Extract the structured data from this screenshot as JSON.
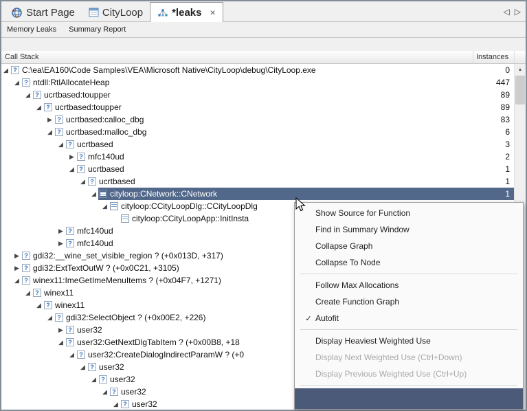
{
  "colors": {
    "selection_bg": "#52688a",
    "selection_text": "#ffffff",
    "menu_partial_bg": "#4a5a78",
    "accent_blue": "#2f6fbe",
    "disabled_text": "#a9a9a9"
  },
  "tab_bar": {
    "tabs": [
      {
        "label": "Start Page",
        "icon": "start-page-globe-icon",
        "active": false
      },
      {
        "label": "CityLoop",
        "icon": "document-window-icon",
        "active": false
      },
      {
        "label": "*leaks",
        "icon": "leak-graph-icon",
        "active": true,
        "close_label": "×"
      }
    ],
    "nav_back_glyph": "◁",
    "nav_forward_glyph": "▷"
  },
  "subtabs": [
    {
      "label": "Memory Leaks"
    },
    {
      "label": "Summary Report"
    }
  ],
  "table": {
    "columns": [
      "Call Stack",
      "Instances"
    ]
  },
  "tree": {
    "expanded_glyph": "◢",
    "collapsed_glyph": "▶",
    "unknown_glyph": "?",
    "rows": [
      {
        "level": 0,
        "state": "expanded",
        "icon": "question",
        "label": "C:\\ea\\EA160\\Code Samples\\VEA\\Microsoft Native\\CityLoop\\debug\\CityLoop.exe",
        "instances": "0",
        "selected": false
      },
      {
        "level": 1,
        "state": "expanded",
        "icon": "question",
        "label": "ntdll:RtlAllocateHeap",
        "instances": "447",
        "selected": false
      },
      {
        "level": 2,
        "state": "expanded",
        "icon": "question",
        "label": "ucrtbased:toupper",
        "instances": "89",
        "selected": false
      },
      {
        "level": 3,
        "state": "expanded",
        "icon": "question",
        "label": "ucrtbased:toupper",
        "instances": "89",
        "selected": false
      },
      {
        "level": 4,
        "state": "collapsed",
        "icon": "question",
        "label": "ucrtbased:calloc_dbg",
        "instances": "83",
        "selected": false
      },
      {
        "level": 4,
        "state": "expanded",
        "icon": "question",
        "label": "ucrtbased:malloc_dbg",
        "instances": "6",
        "selected": false
      },
      {
        "level": 5,
        "state": "expanded",
        "icon": "question",
        "label": "ucrtbased",
        "instances": "3",
        "selected": false
      },
      {
        "level": 6,
        "state": "collapsed",
        "icon": "question",
        "label": "mfc140ud",
        "instances": "2",
        "selected": false
      },
      {
        "level": 6,
        "state": "expanded",
        "icon": "question",
        "label": "ucrtbased",
        "instances": "1",
        "selected": false
      },
      {
        "level": 7,
        "state": "expanded",
        "icon": "question",
        "label": "ucrtbased",
        "instances": "1",
        "selected": false
      },
      {
        "level": 8,
        "state": "expanded",
        "icon": "doc",
        "label": "cityloop:CNetwork::CNetwork",
        "instances": "1",
        "selected": true
      },
      {
        "level": 9,
        "state": "expanded",
        "icon": "doc",
        "label": "cityloop:CCityLoopDlg::CCityLoopDlg",
        "instances": "",
        "selected": false
      },
      {
        "level": 10,
        "state": "leaf",
        "icon": "doc",
        "label": "cityloop:CCityLoopApp::InitInsta",
        "instances": "",
        "selected": false
      },
      {
        "level": 5,
        "state": "collapsed",
        "icon": "question",
        "label": "mfc140ud",
        "instances": "",
        "selected": false
      },
      {
        "level": 5,
        "state": "collapsed",
        "icon": "question",
        "label": "mfc140ud",
        "instances": "",
        "selected": false
      },
      {
        "level": 1,
        "state": "collapsed",
        "icon": "question",
        "label": "gdi32:__wine_set_visible_region ? (+0x013D, +317)",
        "instances": "",
        "selected": false
      },
      {
        "level": 1,
        "state": "collapsed",
        "icon": "question",
        "label": "gdi32:ExtTextOutW ? (+0x0C21, +3105)",
        "instances": "",
        "selected": false
      },
      {
        "level": 1,
        "state": "expanded",
        "icon": "question",
        "label": "winex11:ImeGetImeMenuItems ? (+0x04F7, +1271)",
        "instances": "",
        "selected": false
      },
      {
        "level": 2,
        "state": "expanded",
        "icon": "question",
        "label": "winex11",
        "instances": "",
        "selected": false
      },
      {
        "level": 3,
        "state": "expanded",
        "icon": "question",
        "label": "winex11",
        "instances": "",
        "selected": false
      },
      {
        "level": 4,
        "state": "expanded",
        "icon": "question",
        "label": "gdi32:SelectObject ? (+0x00E2, +226)",
        "instances": "",
        "selected": false
      },
      {
        "level": 5,
        "state": "collapsed",
        "icon": "question",
        "label": "user32",
        "instances": "",
        "selected": false
      },
      {
        "level": 5,
        "state": "expanded",
        "icon": "question",
        "label": "user32:GetNextDlgTabItem ? (+0x00B8, +18",
        "instances": "",
        "selected": false
      },
      {
        "level": 6,
        "state": "expanded",
        "icon": "question",
        "label": "user32:CreateDialogIndirectParamW ? (+0",
        "instances": "",
        "selected": false
      },
      {
        "level": 7,
        "state": "expanded",
        "icon": "question",
        "label": "user32",
        "instances": "",
        "selected": false
      },
      {
        "level": 8,
        "state": "expanded",
        "icon": "question",
        "label": "user32",
        "instances": "",
        "selected": false
      },
      {
        "level": 9,
        "state": "expanded",
        "icon": "question",
        "label": "user32",
        "instances": "",
        "selected": false
      },
      {
        "level": 10,
        "state": "expanded",
        "icon": "question",
        "label": "user32",
        "instances": "",
        "selected": false
      }
    ]
  },
  "context_menu": {
    "check_glyph": "✓",
    "items": [
      {
        "type": "item",
        "label": "Show Source for Function",
        "disabled": false,
        "checked": false,
        "partial": false
      },
      {
        "type": "item",
        "label": "Find in Summary Window",
        "disabled": false,
        "checked": false,
        "partial": false
      },
      {
        "type": "item",
        "label": "Collapse Graph",
        "disabled": false,
        "checked": false,
        "partial": false
      },
      {
        "type": "item",
        "label": "Collapse To Node",
        "disabled": false,
        "checked": false,
        "partial": false
      },
      {
        "type": "separator"
      },
      {
        "type": "item",
        "label": "Follow Max Allocations",
        "disabled": false,
        "checked": false,
        "partial": false
      },
      {
        "type": "item",
        "label": "Create Function Graph",
        "disabled": false,
        "checked": false,
        "partial": false
      },
      {
        "type": "item",
        "label": "Autofit",
        "disabled": false,
        "checked": true,
        "partial": false
      },
      {
        "type": "separator"
      },
      {
        "type": "item",
        "label": "Display Heaviest Weighted Use",
        "disabled": false,
        "checked": false,
        "partial": false
      },
      {
        "type": "item",
        "label": "Display Next Weighted Use (Ctrl+Down)",
        "disabled": true,
        "checked": false,
        "partial": false
      },
      {
        "type": "item",
        "label": "Display Previous Weighted Use (Ctrl+Up)",
        "disabled": true,
        "checked": false,
        "partial": false
      },
      {
        "type": "separator"
      },
      {
        "type": "item",
        "label": "",
        "disabled": false,
        "checked": false,
        "partial": true
      }
    ]
  },
  "scrollbar": {
    "up_glyph": "▲",
    "down_glyph": "▼"
  }
}
